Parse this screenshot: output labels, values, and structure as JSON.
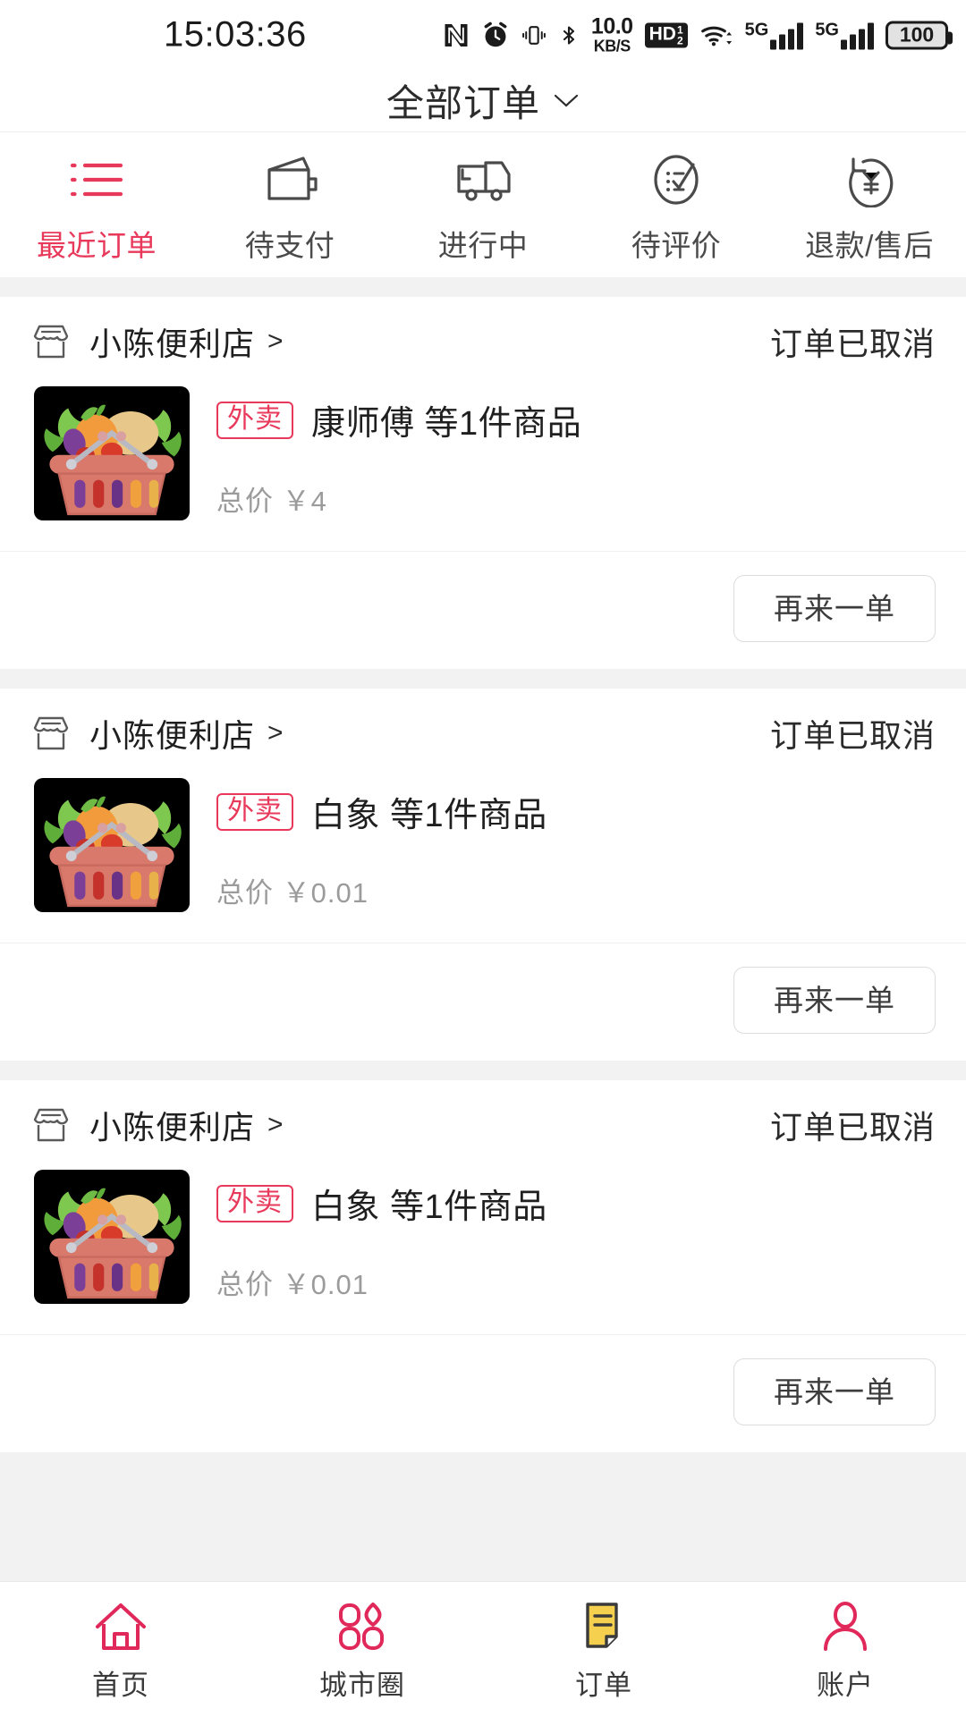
{
  "status_bar": {
    "time": "15:03:36",
    "net_speed_value": "10.0",
    "net_speed_unit": "KB/S",
    "hd_label": "HD",
    "hd_sup": "1",
    "hd_sub": "2",
    "sim1_label": "5G",
    "sim2_label": "5G",
    "battery_level": "100",
    "icons": [
      "nfc-icon",
      "alarm-icon",
      "vibrate-icon",
      "bluetooth-icon",
      "network-speed",
      "hd-voice-icon",
      "wifi-icon",
      "signal-5g-1",
      "signal-5g-2",
      "battery-icon"
    ]
  },
  "header": {
    "title": "全部订单",
    "dropdown_icon": "chevron-down-icon"
  },
  "tabs": [
    {
      "label": "最近订单",
      "icon": "list-icon",
      "active": true
    },
    {
      "label": "待支付",
      "icon": "wallet-icon",
      "active": false
    },
    {
      "label": "进行中",
      "icon": "truck-icon",
      "active": false
    },
    {
      "label": "待评价",
      "icon": "review-icon",
      "active": false
    },
    {
      "label": "退款/售后",
      "icon": "refund-icon",
      "active": false
    }
  ],
  "orders": [
    {
      "store": "小陈便利店",
      "store_arrow": ">",
      "status": "订单已取消",
      "badge": "外卖",
      "goods": "康师傅 等1件商品",
      "price_label": "总价",
      "price": "￥4",
      "action": "再来一单",
      "thumb_icon": "grocery-basket-image"
    },
    {
      "store": "小陈便利店",
      "store_arrow": ">",
      "status": "订单已取消",
      "badge": "外卖",
      "goods": "白象 等1件商品",
      "price_label": "总价",
      "price": "￥0.01",
      "action": "再来一单",
      "thumb_icon": "grocery-basket-image"
    },
    {
      "store": "小陈便利店",
      "store_arrow": ">",
      "status": "订单已取消",
      "badge": "外卖",
      "goods": "白象 等1件商品",
      "price_label": "总价",
      "price": "￥0.01",
      "action": "再来一单",
      "thumb_icon": "grocery-basket-image"
    }
  ],
  "bottom_nav": [
    {
      "label": "首页",
      "icon": "home-icon"
    },
    {
      "label": "城市圈",
      "icon": "city-circle-icon"
    },
    {
      "label": "订单",
      "icon": "order-document-icon"
    },
    {
      "label": "账户",
      "icon": "account-person-icon"
    }
  ],
  "colors": {
    "accent": "#e8395b",
    "text_primary": "#1f1f1f",
    "text_secondary": "#9b9b9b",
    "page_bg": "#f2f2f2",
    "card_bg": "#ffffff",
    "order_icon_yellow": "#f5cf4e"
  }
}
